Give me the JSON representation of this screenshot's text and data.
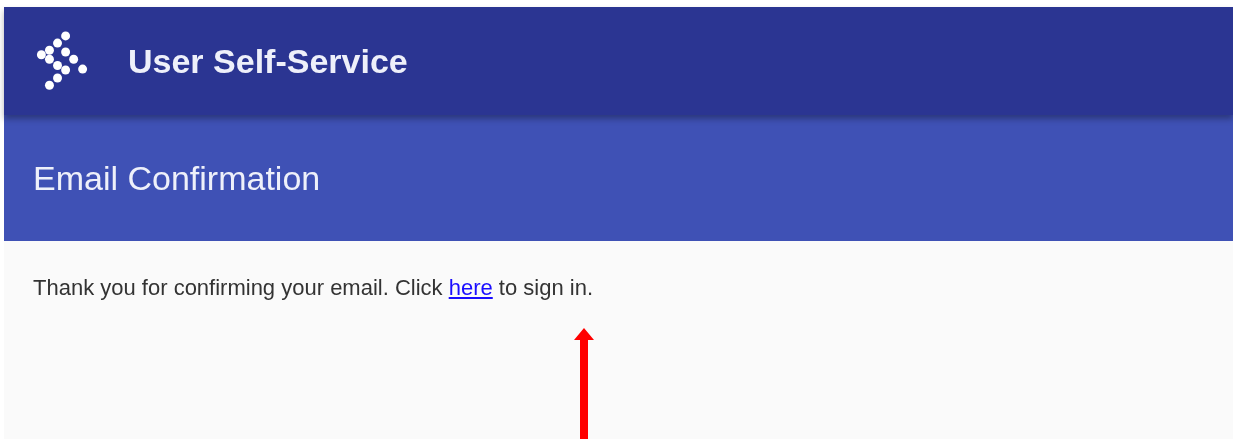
{
  "header": {
    "title": "User Self-Service"
  },
  "page": {
    "title": "Email Confirmation"
  },
  "message": {
    "before": "Thank you for confirming your email. Click ",
    "link": "here",
    "after": " to sign in."
  }
}
